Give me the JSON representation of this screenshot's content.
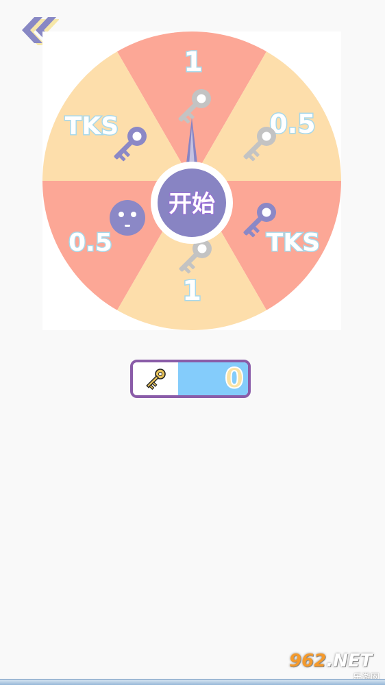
{
  "back_button": {
    "icon": "double-chevron-left-icon",
    "color": "#8888c4"
  },
  "wheel": {
    "segments": [
      {
        "label": "1",
        "reward_icon": "key-icon",
        "color": "#fca796"
      },
      {
        "label": "0.5",
        "reward_icon": "key-icon",
        "color": "#fddeab"
      },
      {
        "label": "TKS",
        "reward_icon": "key-icon",
        "color": "#fca796"
      },
      {
        "label": "1",
        "reward_icon": "key-icon",
        "color": "#fddeab"
      },
      {
        "label": "0.5",
        "reward_icon": "smiley-icon",
        "color": "#fca796"
      },
      {
        "label": "TKS",
        "reward_icon": "key-icon",
        "color": "#fddeab"
      }
    ],
    "start_button_label": "开始",
    "pointer_color": "#8884c3"
  },
  "key_counter": {
    "icon": "golden-key-icon",
    "value": "0"
  },
  "watermark": {
    "brand_prefix": "962",
    "brand_suffix": ".NET",
    "sub": "乐游网"
  },
  "colors": {
    "accent_purple": "#8a5ca8",
    "key_purple": "#8b88c6",
    "counter_blue": "#84ccfb"
  }
}
